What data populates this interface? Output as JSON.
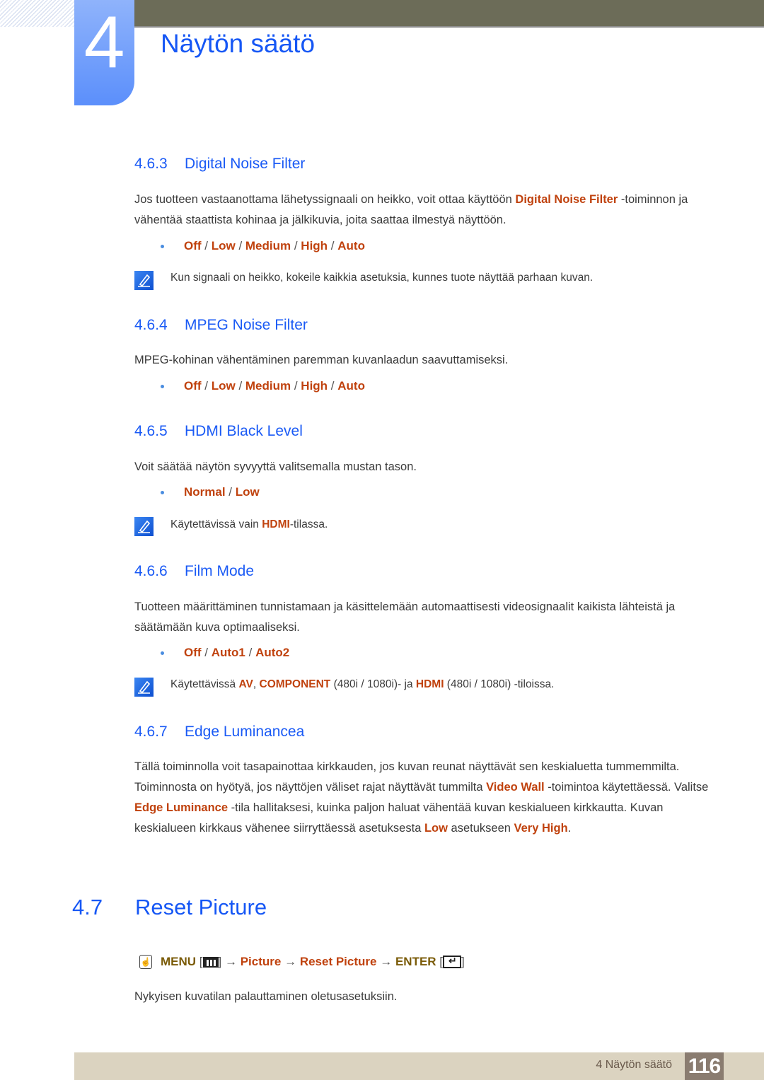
{
  "chapter": {
    "number": "4",
    "title": "Näytön säätö"
  },
  "sections": {
    "s463": {
      "num": "4.6.3",
      "title": "Digital Noise Filter",
      "para_part1": "Jos tuotteen vastaanottama lähetyssignaali on heikko, voit ottaa käyttöön ",
      "para_highlight": "Digital Noise Filter",
      "para_part2": " -toiminnon ja vähentää staattista kohinaa ja jälkikuvia, joita saattaa ilmestyä näyttöön.",
      "options": [
        "Off",
        "Low",
        "Medium",
        "High",
        "Auto"
      ],
      "note": "Kun signaali on heikko, kokeile kaikkia asetuksia, kunnes tuote näyttää parhaan kuvan."
    },
    "s464": {
      "num": "4.6.4",
      "title": "MPEG Noise Filter",
      "para": "MPEG-kohinan vähentäminen paremman kuvanlaadun saavuttamiseksi.",
      "options": [
        "Off",
        "Low",
        "Medium",
        "High",
        "Auto"
      ]
    },
    "s465": {
      "num": "4.6.5",
      "title": "HDMI Black Level",
      "para": "Voit säätää näytön syvyyttä valitsemalla mustan tason.",
      "options": [
        "Normal",
        "Low"
      ],
      "note_part1": "Käytettävissä vain ",
      "note_highlight": "HDMI",
      "note_part2": "-tilassa."
    },
    "s466": {
      "num": "4.6.6",
      "title": "Film Mode",
      "para": "Tuotteen määrittäminen tunnistamaan ja käsittelemään automaattisesti videosignaalit kaikista lähteistä ja säätämään kuva optimaaliseksi.",
      "options": [
        "Off",
        "Auto1",
        "Auto2"
      ],
      "note_part1": "Käytettävissä ",
      "note_hl1": "AV",
      "note_sep": ", ",
      "note_hl2": "COMPONENT",
      "note_part2": " (480i / 1080i)- ja ",
      "note_hl3": "HDMI",
      "note_part3": " (480i / 1080i) -tiloissa."
    },
    "s467": {
      "num": "4.6.7",
      "title": "Edge Luminancea",
      "p1": "Tällä toiminnolla voit tasapainottaa kirkkauden, jos kuvan reunat näyttävät sen keskialuetta tummemmilta. Toiminnosta on hyötyä, jos näyttöjen väliset rajat näyttävät tummilta ",
      "hl1": "Video Wall",
      "p2": " -toimintoa käytettäessä. Valitse ",
      "hl2": "Edge Luminance",
      "p3": " -tila hallitaksesi, kuinka paljon haluat vähentää kuvan keskialueen kirkkautta. Kuvan keskialueen kirkkaus vähenee siirryttäessä asetuksesta ",
      "hl3": "Low",
      "p4": " asetukseen ",
      "hl4": "Very High",
      "p5": "."
    },
    "s47": {
      "num": "4.7",
      "title": "Reset Picture",
      "menu_label": "MENU",
      "arrow": "→",
      "path1": "Picture",
      "path2": "Reset Picture",
      "enter_label": "ENTER",
      "para": "Nykyisen kuvatilan palauttaminen oletusasetuksiin."
    }
  },
  "option_separator": " / ",
  "footer": {
    "text": "4 Näytön säätö",
    "page": "116"
  }
}
